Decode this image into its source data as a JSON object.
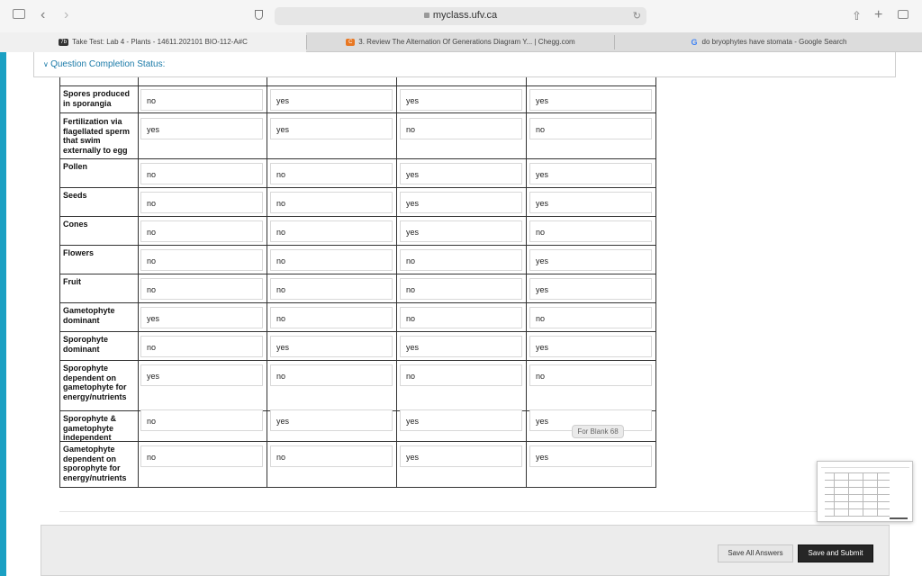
{
  "browser": {
    "url": "myclass.ufv.ca",
    "tabs": [
      {
        "favicon": "7b",
        "title": "Take Test: Lab 4 - Plants - 14611.202101 BIO-112-A#C",
        "active": true
      },
      {
        "favicon": "C",
        "title": "3. Review The Alternation Of Generations Diagram Y... | Chegg.com",
        "active": false
      },
      {
        "favicon": "G",
        "title": "do bryophytes have stomata - Google Search",
        "active": false
      }
    ],
    "icons": [
      "sidebar-icon",
      "back-icon",
      "forward-icon",
      "privacy-shield-icon",
      "reload-icon",
      "share-icon",
      "new-tab-icon",
      "tab-overview-icon"
    ]
  },
  "status": {
    "label": "Question Completion Status:"
  },
  "table": {
    "rows": [
      {
        "label": "Spores produced in sporangia",
        "answers": [
          "no",
          "yes",
          "yes",
          "yes"
        ]
      },
      {
        "label": "Fertilization via flagellated sperm that swim externally to egg",
        "answers": [
          "yes",
          "yes",
          "no",
          "no"
        ]
      },
      {
        "label": "Pollen",
        "answers": [
          "no",
          "no",
          "yes",
          "yes"
        ]
      },
      {
        "label": "Seeds",
        "answers": [
          "no",
          "no",
          "yes",
          "yes"
        ]
      },
      {
        "label": "Cones",
        "answers": [
          "no",
          "no",
          "yes",
          "no"
        ]
      },
      {
        "label": "Flowers",
        "answers": [
          "no",
          "no",
          "no",
          "yes"
        ]
      },
      {
        "label": "Fruit",
        "answers": [
          "no",
          "no",
          "no",
          "yes"
        ]
      },
      {
        "label": "Gametophyte dominant",
        "answers": [
          "yes",
          "no",
          "no",
          "no"
        ]
      },
      {
        "label": "Sporophyte dominant",
        "answers": [
          "no",
          "yes",
          "yes",
          "yes"
        ]
      },
      {
        "label": "Sporophyte dependent on gametophyte for energy/nutrients",
        "answers": [
          "yes",
          "no",
          "no",
          "no"
        ]
      },
      {
        "label": "Sporophyte & gametophyte independent",
        "answers": [
          "no",
          "yes",
          "yes",
          "yes"
        ]
      },
      {
        "label": "Gametophyte dependent on sporophyte for energy/nutrients",
        "answers": [
          "no",
          "no",
          "yes",
          "yes"
        ]
      }
    ]
  },
  "tooltip": {
    "text": "For Blank 68"
  },
  "footer": {
    "save_all_label": "Save All Answers",
    "submit_label": "Save and Submit"
  },
  "colors": {
    "accent": "#1aa0c3",
    "status_text": "#1a7aa8",
    "submit_bg": "#262626"
  }
}
